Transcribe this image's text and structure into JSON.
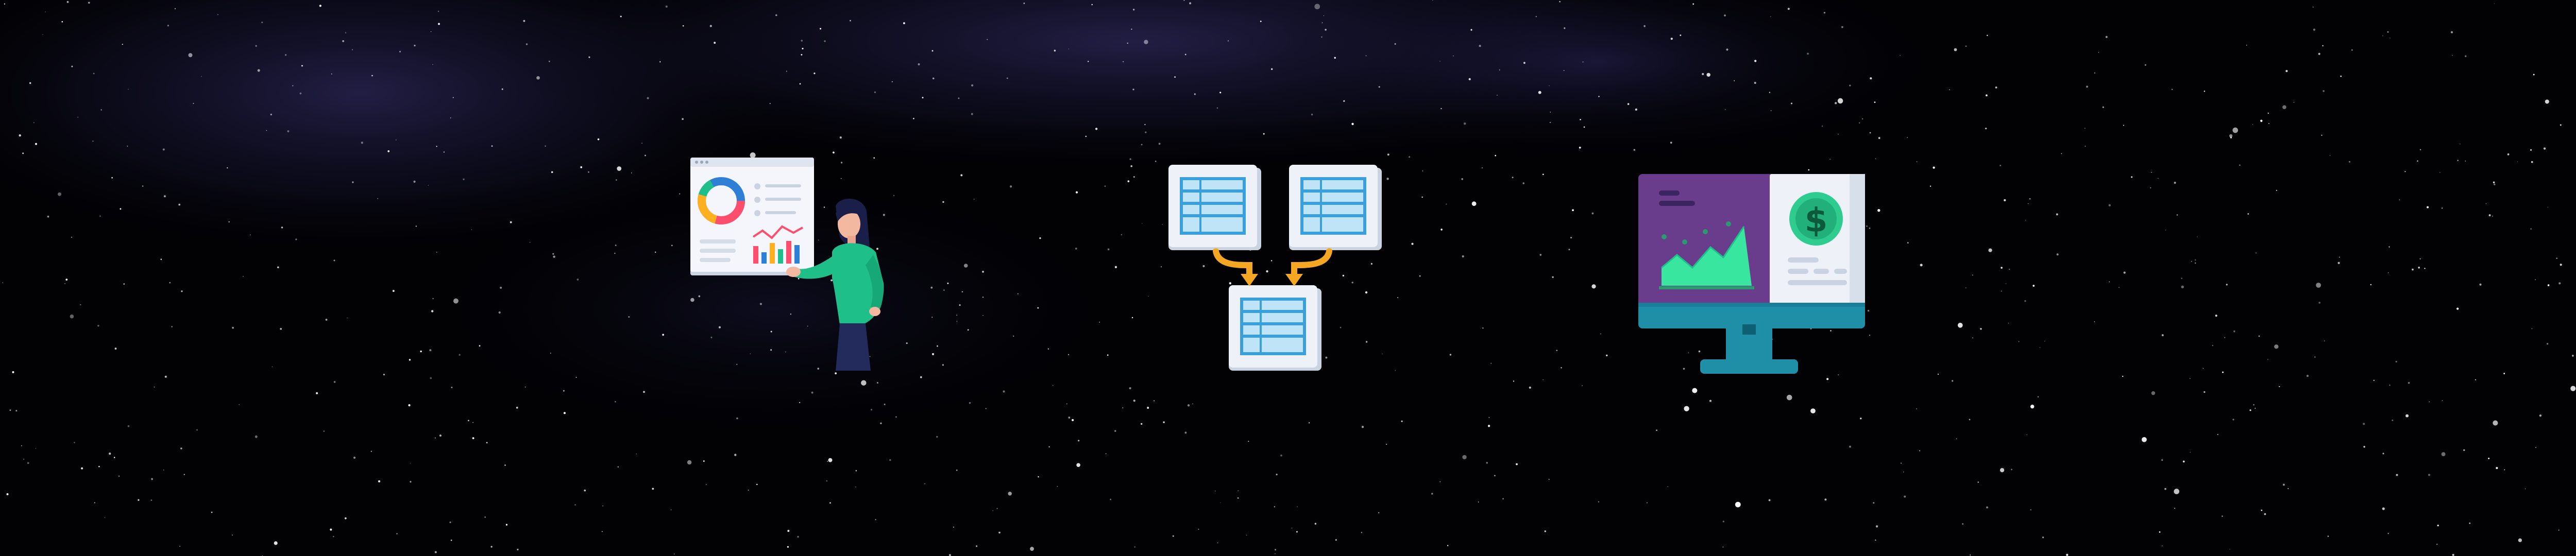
{
  "scene": {
    "background": "starfield",
    "colors": {
      "sky": "#000000",
      "nebula": "#2a2560",
      "star": "#ffffff"
    }
  },
  "illustrations": [
    {
      "name": "analyst-presenting-dashboard",
      "icon": "woman-with-dashboard-icon"
    },
    {
      "name": "table-merge",
      "icon": "merge-tables-icon"
    },
    {
      "name": "financial-monitor",
      "icon": "monitor-dollar-chart-icon"
    }
  ],
  "palette": {
    "card": "#eef2f8",
    "card_shadow": "#c9d3e2",
    "table_blue": "#3aa0dc",
    "table_light": "#bfe3f7",
    "arrow": "#f5a623",
    "shirt": "#1fbf8a",
    "hair": "#1a1f4a",
    "pants": "#232a5c",
    "monitor_purple": "#6a3d8c",
    "monitor_teal": "#1f8fa8",
    "money_green": "#2ecc8f",
    "chart_green": "#39e6a0"
  }
}
